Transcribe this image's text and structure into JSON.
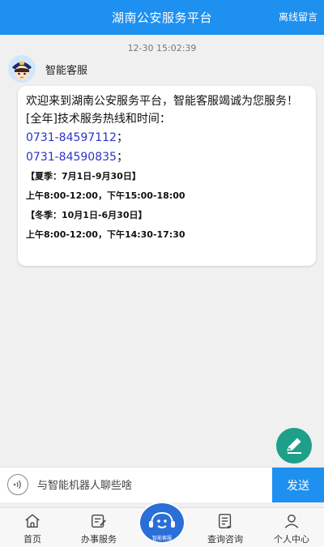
{
  "header": {
    "title": "湖南公安服务平台",
    "action_label": "离线留言"
  },
  "chat": {
    "timestamp": "12-30 15:02:39",
    "agent_name": "智能客服",
    "message": {
      "greeting": "欢迎来到湖南公安服务平台，智能客服竭诚为您服务！",
      "hotline_title": "[全年]技术服务热线和时间：",
      "phones": [
        "0731-84597112",
        "0731-84590835"
      ],
      "phone_separator": "；",
      "summer_title": "【夏季：7月1日-9月30日】",
      "summer_hours": "上午8:00-12:00，下午15:00-18:00",
      "winter_title": "【冬季：10月1日-6月30日】",
      "winter_hours": "上午8:00-12:00，下午14:30-17:30"
    }
  },
  "input": {
    "placeholder": "与智能机器人聊些啥",
    "send_label": "发送",
    "voice_icon": "voice-wave-icon"
  },
  "fab": {
    "icon": "edit-pencil-icon",
    "color": "#1e9f8a"
  },
  "tabbar": {
    "tabs": [
      {
        "label": "首页",
        "icon": "home-icon"
      },
      {
        "label": "办事服务",
        "icon": "service-icon"
      },
      {
        "label": "智能客服",
        "icon": "robot-icon"
      },
      {
        "label": "查询咨询",
        "icon": "query-icon"
      },
      {
        "label": "个人中心",
        "icon": "user-icon"
      }
    ]
  },
  "colors": {
    "primary": "#1e90f0",
    "phone_link": "#2a33c8",
    "center_tab": "#2a6fd8"
  }
}
